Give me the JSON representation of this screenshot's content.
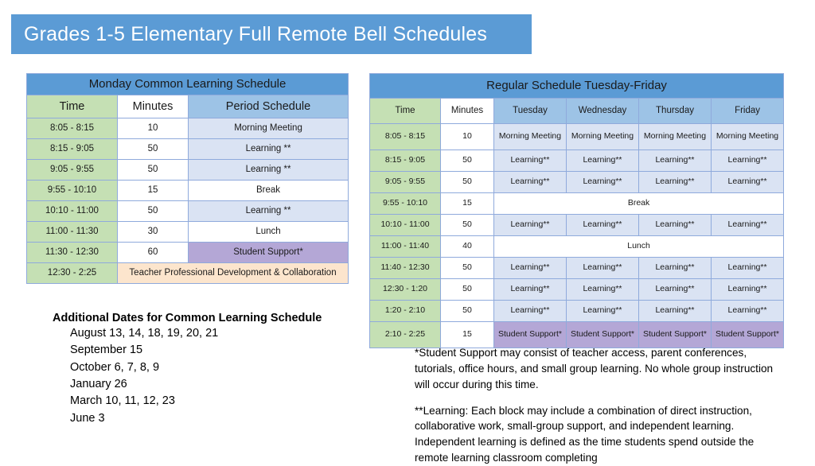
{
  "slide": {
    "title": "Grades 1-5 Elementary Full Remote Bell Schedules"
  },
  "monday_table": {
    "banner": "Monday Common Learning Schedule",
    "headers": [
      "Time",
      "Minutes",
      "Period Schedule"
    ],
    "rows": [
      {
        "time": "8:05 - 8:15",
        "minutes": "10",
        "period": "Morning Meeting",
        "style": "blue"
      },
      {
        "time": "8:15 - 9:05",
        "minutes": "50",
        "period": "Learning **",
        "style": "blue"
      },
      {
        "time": "9:05 - 9:55",
        "minutes": "50",
        "period": "Learning **",
        "style": "blue"
      },
      {
        "time": "9:55 - 10:10",
        "minutes": "15",
        "period": "Break",
        "style": "white"
      },
      {
        "time": "10:10 - 11:00",
        "minutes": "50",
        "period": "Learning **",
        "style": "blue"
      },
      {
        "time": "11:00 - 11:30",
        "minutes": "30",
        "period": "Lunch",
        "style": "white"
      },
      {
        "time": "11:30 - 12:30",
        "minutes": "60",
        "period": "Student Support*",
        "style": "purple"
      }
    ],
    "last_row": {
      "time": "12:30 - 2:25",
      "label": "Teacher Professional Development & Collaboration"
    }
  },
  "regular_table": {
    "banner": "Regular Schedule Tuesday-Friday",
    "headers": [
      "Time",
      "Minutes",
      "Tuesday",
      "Wednesday",
      "Thursday",
      "Friday"
    ],
    "rows": [
      {
        "time": "8:05 - 8:15",
        "minutes": "10",
        "cells": [
          "Morning Meeting",
          "Morning Meeting",
          "Morning Meeting",
          "Morning Meeting"
        ],
        "style": "blue",
        "tall": true
      },
      {
        "time": "8:15 - 9:05",
        "minutes": "50",
        "cells": [
          "Learning**",
          "Learning**",
          "Learning**",
          "Learning**"
        ],
        "style": "blue",
        "tall": false
      },
      {
        "time": "9:05 - 9:55",
        "minutes": "50",
        "cells": [
          "Learning**",
          "Learning**",
          "Learning**",
          "Learning**"
        ],
        "style": "blue",
        "tall": false
      },
      {
        "time": "9:55 - 10:10",
        "minutes": "15",
        "span": "Break",
        "style": "white",
        "tall": false
      },
      {
        "time": "10:10 - 11:00",
        "minutes": "50",
        "cells": [
          "Learning**",
          "Learning**",
          "Learning**",
          "Learning**"
        ],
        "style": "blue",
        "tall": false
      },
      {
        "time": "11:00 - 11:40",
        "minutes": "40",
        "span": "Lunch",
        "style": "white",
        "tall": false
      },
      {
        "time": "11:40 - 12:30",
        "minutes": "50",
        "cells": [
          "Learning**",
          "Learning**",
          "Learning**",
          "Learning**"
        ],
        "style": "blue",
        "tall": false
      },
      {
        "time": "12:30 - 1:20",
        "minutes": "50",
        "cells": [
          "Learning**",
          "Learning**",
          "Learning**",
          "Learning**"
        ],
        "style": "blue",
        "tall": false
      },
      {
        "time": "1:20 - 2:10",
        "minutes": "50",
        "cells": [
          "Learning**",
          "Learning**",
          "Learning**",
          "Learning**"
        ],
        "style": "blue",
        "tall": false
      },
      {
        "time": "2:10 - 2:25",
        "minutes": "15",
        "cells": [
          "Student Support*",
          "Student Support*",
          "Student Support*",
          "Student Support*"
        ],
        "style": "purple",
        "tall": true
      }
    ]
  },
  "additional_dates": {
    "heading": "Additional Dates for Common Learning Schedule",
    "items": [
      "August 13, 14, 18, 19, 20, 21",
      "September 15",
      "October 6, 7, 8, 9",
      "January 26",
      "March 10, 11, 12, 23",
      "June 3"
    ]
  },
  "footnotes": {
    "student_support": "*Student Support may consist of teacher access, parent conferences, tutorials, office hours, and small group learning. No whole group instruction will occur during this time.",
    "learning": "**Learning:  Each block may include a combination of direct instruction, collaborative work, small-group support, and independent learning. Independent learning is defined as the time students spend outside the remote learning classroom completing"
  },
  "colors": {
    "banner_blue": "#5b9bd5",
    "header_green": "#c5e0b4",
    "header_blue": "#9dc3e6",
    "cell_blue": "#dae3f3",
    "cell_purple": "#b4a7d6",
    "cell_peach": "#fce5cd",
    "border": "#8faadc"
  }
}
